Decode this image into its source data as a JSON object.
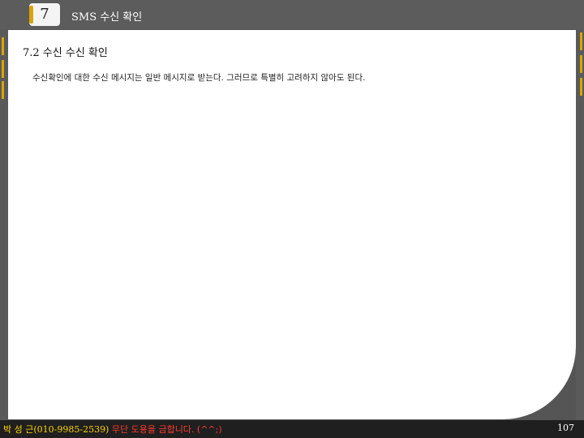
{
  "header": {
    "chapter_number": "7",
    "title": "SMS 수신 확인"
  },
  "section": {
    "title": "7.2 수신 수신 확인",
    "body": "수신확인에 대한 수신 메시지는 일반 메시지로 받는다. 그러므로 특별히 고려하지 않아도 된다."
  },
  "footer": {
    "author": "박 성 근(010-9985-2539) ",
    "notice": "무단 도용을 금합니다. (^^;)",
    "page_number": "107"
  },
  "colors": {
    "accent": "#d9a400",
    "footer_author": "#ffd400",
    "footer_notice": "#ff3b2f",
    "background": "#555555"
  }
}
